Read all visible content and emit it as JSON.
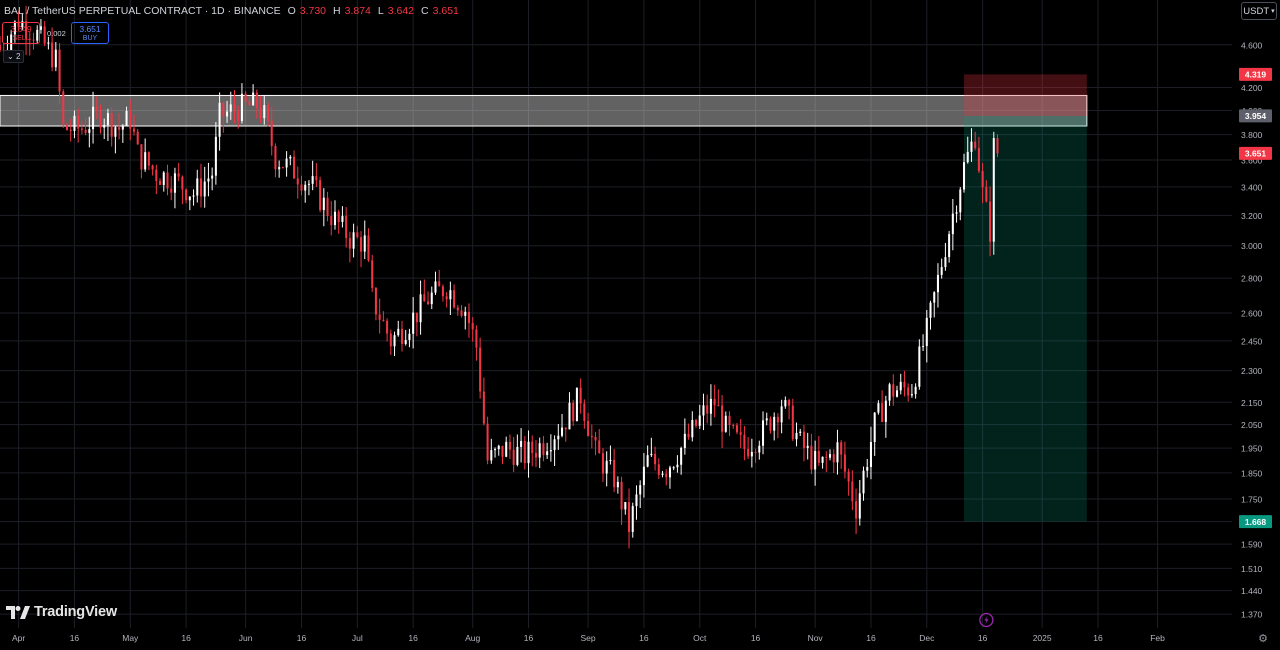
{
  "header": {
    "symbol": "BAL / TetherUS PERPETUAL CONTRACT · 1D · BINANCE",
    "o_label": "O",
    "o_value": "3.730",
    "h_label": "H",
    "h_value": "3.874",
    "l_label": "L",
    "l_value": "3.642",
    "c_label": "C",
    "c_value": "3.651"
  },
  "trade": {
    "sell_price": "3.649",
    "sell_label": "SELL",
    "buy_price": "3.651",
    "buy_label": "BUY",
    "spread": "0.002",
    "collapse_count": "2"
  },
  "currency": "USDT",
  "brand": "TradingView",
  "colors": {
    "background": "#000000",
    "up": "#ffffff",
    "down": "#f23645",
    "grid": "#1c1f26",
    "zone_fill": "#d9d9d9",
    "stop_fill": "#f23645",
    "target_fill": "#089981"
  },
  "chart_data": {
    "type": "candlestick",
    "scale": "log",
    "y_ticks": [
      4.6,
      4.2,
      4.0,
      3.8,
      3.6,
      3.4,
      3.2,
      3.0,
      2.8,
      2.6,
      2.45,
      2.3,
      2.15,
      2.05,
      1.95,
      1.85,
      1.75,
      1.668,
      1.59,
      1.51,
      1.44,
      1.37
    ],
    "y_range": [
      1.33,
      5.06
    ],
    "x_start": "2024-03-27",
    "x_end": "2025-02-21",
    "x_ticks": [
      {
        "label": "Apr",
        "date": "2024-04-01"
      },
      {
        "label": "16",
        "date": "2024-04-16"
      },
      {
        "label": "May",
        "date": "2024-05-01"
      },
      {
        "label": "16",
        "date": "2024-05-16"
      },
      {
        "label": "Jun",
        "date": "2024-06-01"
      },
      {
        "label": "16",
        "date": "2024-06-16"
      },
      {
        "label": "Jul",
        "date": "2024-07-01"
      },
      {
        "label": "16",
        "date": "2024-07-16"
      },
      {
        "label": "Aug",
        "date": "2024-08-01"
      },
      {
        "label": "16",
        "date": "2024-08-16"
      },
      {
        "label": "Sep",
        "date": "2024-09-01"
      },
      {
        "label": "16",
        "date": "2024-09-16"
      },
      {
        "label": "Oct",
        "date": "2024-10-01"
      },
      {
        "label": "16",
        "date": "2024-10-16"
      },
      {
        "label": "Nov",
        "date": "2024-11-01"
      },
      {
        "label": "16",
        "date": "2024-11-16"
      },
      {
        "label": "Dec",
        "date": "2024-12-01"
      },
      {
        "label": "16",
        "date": "2024-12-16"
      },
      {
        "label": "2025",
        "date": "2025-01-01"
      },
      {
        "label": "16",
        "date": "2025-01-16"
      },
      {
        "label": "Feb",
        "date": "2025-02-01"
      }
    ],
    "price_labels": [
      {
        "value": 4.319,
        "text": "4.319",
        "color": "#f23645"
      },
      {
        "value": 3.954,
        "text": "3.954",
        "color": "#5d606b"
      },
      {
        "value": 3.651,
        "text": "3.651",
        "color": "#f23645"
      },
      {
        "value": 1.668,
        "text": "1.668",
        "color": "#089981"
      }
    ],
    "resistance_zone": {
      "top": 4.13,
      "bottom": 3.87,
      "from": "2024-03-27",
      "to": "2025-01-13"
    },
    "position": {
      "entry": 3.954,
      "stop": 4.319,
      "target": 1.668,
      "from": "2024-12-11",
      "to": "2025-01-13"
    },
    "anchors": [
      [
        "2024-03-27",
        4.55
      ],
      [
        "2024-04-01",
        4.85
      ],
      [
        "2024-04-06",
        4.7
      ],
      [
        "2024-04-11",
        4.45
      ],
      [
        "2024-04-13",
        3.85
      ],
      [
        "2024-04-18",
        3.85
      ],
      [
        "2024-04-23",
        3.97
      ],
      [
        "2024-04-28",
        3.85
      ],
      [
        "2024-05-01",
        3.93
      ],
      [
        "2024-05-03",
        3.65
      ],
      [
        "2024-05-08",
        3.5
      ],
      [
        "2024-05-13",
        3.45
      ],
      [
        "2024-05-18",
        3.35
      ],
      [
        "2024-05-23",
        3.5
      ],
      [
        "2024-05-25",
        3.95
      ],
      [
        "2024-05-30",
        4.02
      ],
      [
        "2024-06-04",
        4.05
      ],
      [
        "2024-06-06",
        3.95
      ],
      [
        "2024-06-09",
        3.62
      ],
      [
        "2024-06-14",
        3.52
      ],
      [
        "2024-06-19",
        3.4
      ],
      [
        "2024-06-24",
        3.2
      ],
      [
        "2024-06-29",
        3.05
      ],
      [
        "2024-07-03",
        3.02
      ],
      [
        "2024-07-05",
        2.68
      ],
      [
        "2024-07-10",
        2.45
      ],
      [
        "2024-07-15",
        2.55
      ],
      [
        "2024-07-20",
        2.68
      ],
      [
        "2024-07-25",
        2.75
      ],
      [
        "2024-07-30",
        2.62
      ],
      [
        "2024-08-02",
        2.42
      ],
      [
        "2024-08-05",
        1.9
      ],
      [
        "2024-08-10",
        1.95
      ],
      [
        "2024-08-15",
        1.92
      ],
      [
        "2024-08-20",
        1.97
      ],
      [
        "2024-08-25",
        2.05
      ],
      [
        "2024-08-30",
        2.18
      ],
      [
        "2024-09-03",
        1.93
      ],
      [
        "2024-09-08",
        1.83
      ],
      [
        "2024-09-12",
        1.65
      ],
      [
        "2024-09-17",
        1.9
      ],
      [
        "2024-09-22",
        1.87
      ],
      [
        "2024-09-27",
        1.97
      ],
      [
        "2024-10-02",
        2.1
      ],
      [
        "2024-10-05",
        2.15
      ],
      [
        "2024-10-08",
        2.03
      ],
      [
        "2024-10-13",
        1.95
      ],
      [
        "2024-10-18",
        2.02
      ],
      [
        "2024-10-23",
        2.15
      ],
      [
        "2024-10-28",
        1.97
      ],
      [
        "2024-11-02",
        1.87
      ],
      [
        "2024-11-07",
        1.95
      ],
      [
        "2024-11-12",
        1.72
      ],
      [
        "2024-11-17",
        2.05
      ],
      [
        "2024-11-21",
        2.2
      ],
      [
        "2024-11-27",
        2.22
      ],
      [
        "2024-12-01",
        2.5
      ],
      [
        "2024-12-06",
        3.0
      ],
      [
        "2024-12-11",
        3.55
      ],
      [
        "2024-12-14",
        3.8
      ],
      [
        "2024-12-16",
        3.35
      ],
      [
        "2024-12-18",
        3.1
      ],
      [
        "2024-12-19",
        3.7
      ],
      [
        "2024-12-20",
        3.651
      ]
    ]
  }
}
